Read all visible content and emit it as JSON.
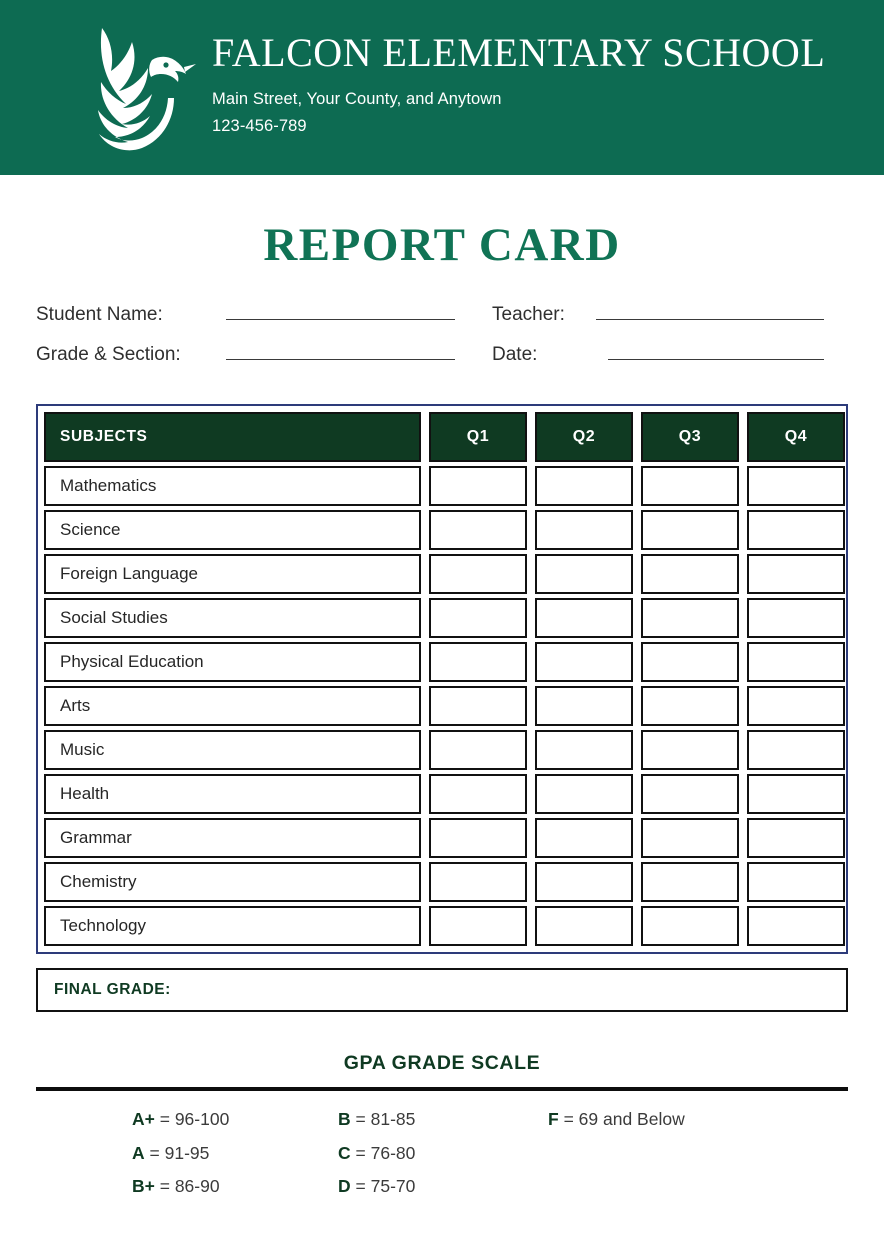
{
  "header": {
    "logo_icon": "falcon-bird-logo",
    "school_name": "FALCON ELEMENTARY SCHOOL",
    "address": "Main Street, Your County, and Anytown",
    "phone": "123-456-789",
    "banner_color": "#0d6b52"
  },
  "title": "REPORT CARD",
  "student_info": {
    "student_name_label": "Student Name:",
    "student_name_value": "",
    "grade_section_label": "Grade & Section:",
    "grade_section_value": "",
    "teacher_label": "Teacher:",
    "teacher_value": "",
    "date_label": "Date:",
    "date_value": ""
  },
  "grades_table": {
    "border_color": "#2d3b7a",
    "header_bg": "#0f3a22",
    "columns": [
      "SUBJECTS",
      "Q1",
      "Q2",
      "Q3",
      "Q4"
    ],
    "rows": [
      {
        "subject": "Mathematics",
        "q1": "",
        "q2": "",
        "q3": "",
        "q4": ""
      },
      {
        "subject": "Science",
        "q1": "",
        "q2": "",
        "q3": "",
        "q4": ""
      },
      {
        "subject": "Foreign Language",
        "q1": "",
        "q2": "",
        "q3": "",
        "q4": ""
      },
      {
        "subject": "Social Studies",
        "q1": "",
        "q2": "",
        "q3": "",
        "q4": ""
      },
      {
        "subject": "Physical Education",
        "q1": "",
        "q2": "",
        "q3": "",
        "q4": ""
      },
      {
        "subject": "Arts",
        "q1": "",
        "q2": "",
        "q3": "",
        "q4": ""
      },
      {
        "subject": "Music",
        "q1": "",
        "q2": "",
        "q3": "",
        "q4": ""
      },
      {
        "subject": "Health",
        "q1": "",
        "q2": "",
        "q3": "",
        "q4": ""
      },
      {
        "subject": "Grammar",
        "q1": "",
        "q2": "",
        "q3": "",
        "q4": ""
      },
      {
        "subject": "Chemistry",
        "q1": "",
        "q2": "",
        "q3": "",
        "q4": ""
      },
      {
        "subject": "Technology",
        "q1": "",
        "q2": "",
        "q3": "",
        "q4": ""
      }
    ]
  },
  "final_grade": {
    "label": "FINAL GRADE:",
    "value": ""
  },
  "gpa_scale": {
    "title": "GPA GRADE SCALE",
    "accent_color": "#0f3a22",
    "column1": [
      {
        "letter": "A+",
        "range": "= 96-100"
      },
      {
        "letter": "A",
        "range": "= 91-95"
      },
      {
        "letter": "B+",
        "range": "= 86-90"
      }
    ],
    "column2": [
      {
        "letter": "B",
        "range": "= 81-85"
      },
      {
        "letter": "C",
        "range": "= 76-80"
      },
      {
        "letter": "D",
        "range": "= 75-70"
      }
    ],
    "column3": [
      {
        "letter": "F",
        "range": "= 69 and Below"
      }
    ]
  }
}
